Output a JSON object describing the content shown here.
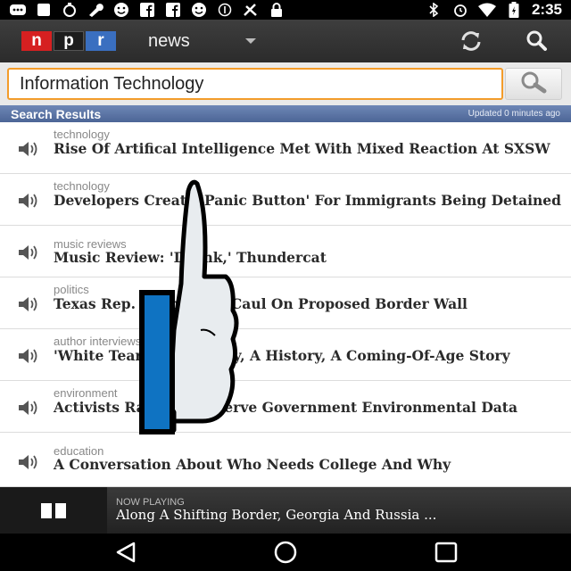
{
  "status_bar": {
    "time": "2:35",
    "left_icons": [
      "message-icon",
      "notification-icon",
      "timer-icon",
      "wrench-icon",
      "smiley-icon",
      "facebook-icon",
      "facebook-icon",
      "smiley-icon",
      "info-icon",
      "no-signal-icon",
      "lock-icon"
    ],
    "right_icons": [
      "bluetooth-icon",
      "alarm-icon",
      "wifi-icon",
      "battery-icon"
    ]
  },
  "action_bar": {
    "logo": {
      "n": "n",
      "p": "p",
      "r": "r"
    },
    "section": "news",
    "refresh_icon": "refresh-icon",
    "search_icon": "search-icon"
  },
  "search": {
    "value": "Information Technology",
    "button_icon": "magnifier-icon",
    "accent": "#f39c2a"
  },
  "results": {
    "title": "Search Results",
    "updated": "Updated 0 minutes ago",
    "items": [
      {
        "category": "technology",
        "title": "Rise Of Artifical Intelligence Met With Mixed Reaction At SXSW"
      },
      {
        "category": "technology",
        "title": "Developers Create 'Panic Button' For Immigrants Being Detained"
      },
      {
        "category": "music reviews",
        "title": "Music Review: 'Drunk,' Thundercat"
      },
      {
        "category": "politics",
        "title": "Texas Rep. Michael McCaul On Proposed Border Wall"
      },
      {
        "category": "author interviews",
        "title": "'White Tears': A Mystery, A History, A Coming-Of-Age Story"
      },
      {
        "category": "environment",
        "title": "Activists Race To Preserve Government Environmental Data"
      },
      {
        "category": "education",
        "title": "A Conversation About Who Needs College And Why"
      }
    ]
  },
  "now_playing": {
    "label": "NOW PLAYING",
    "title": "Along A Shifting Border, Georgia And Russia ..."
  },
  "nav": [
    "back-icon",
    "home-icon",
    "recents-icon"
  ],
  "colors": {
    "npr_red": "#d62021",
    "npr_blue": "#3a6fc0",
    "header_blue": "#5c75a6"
  }
}
